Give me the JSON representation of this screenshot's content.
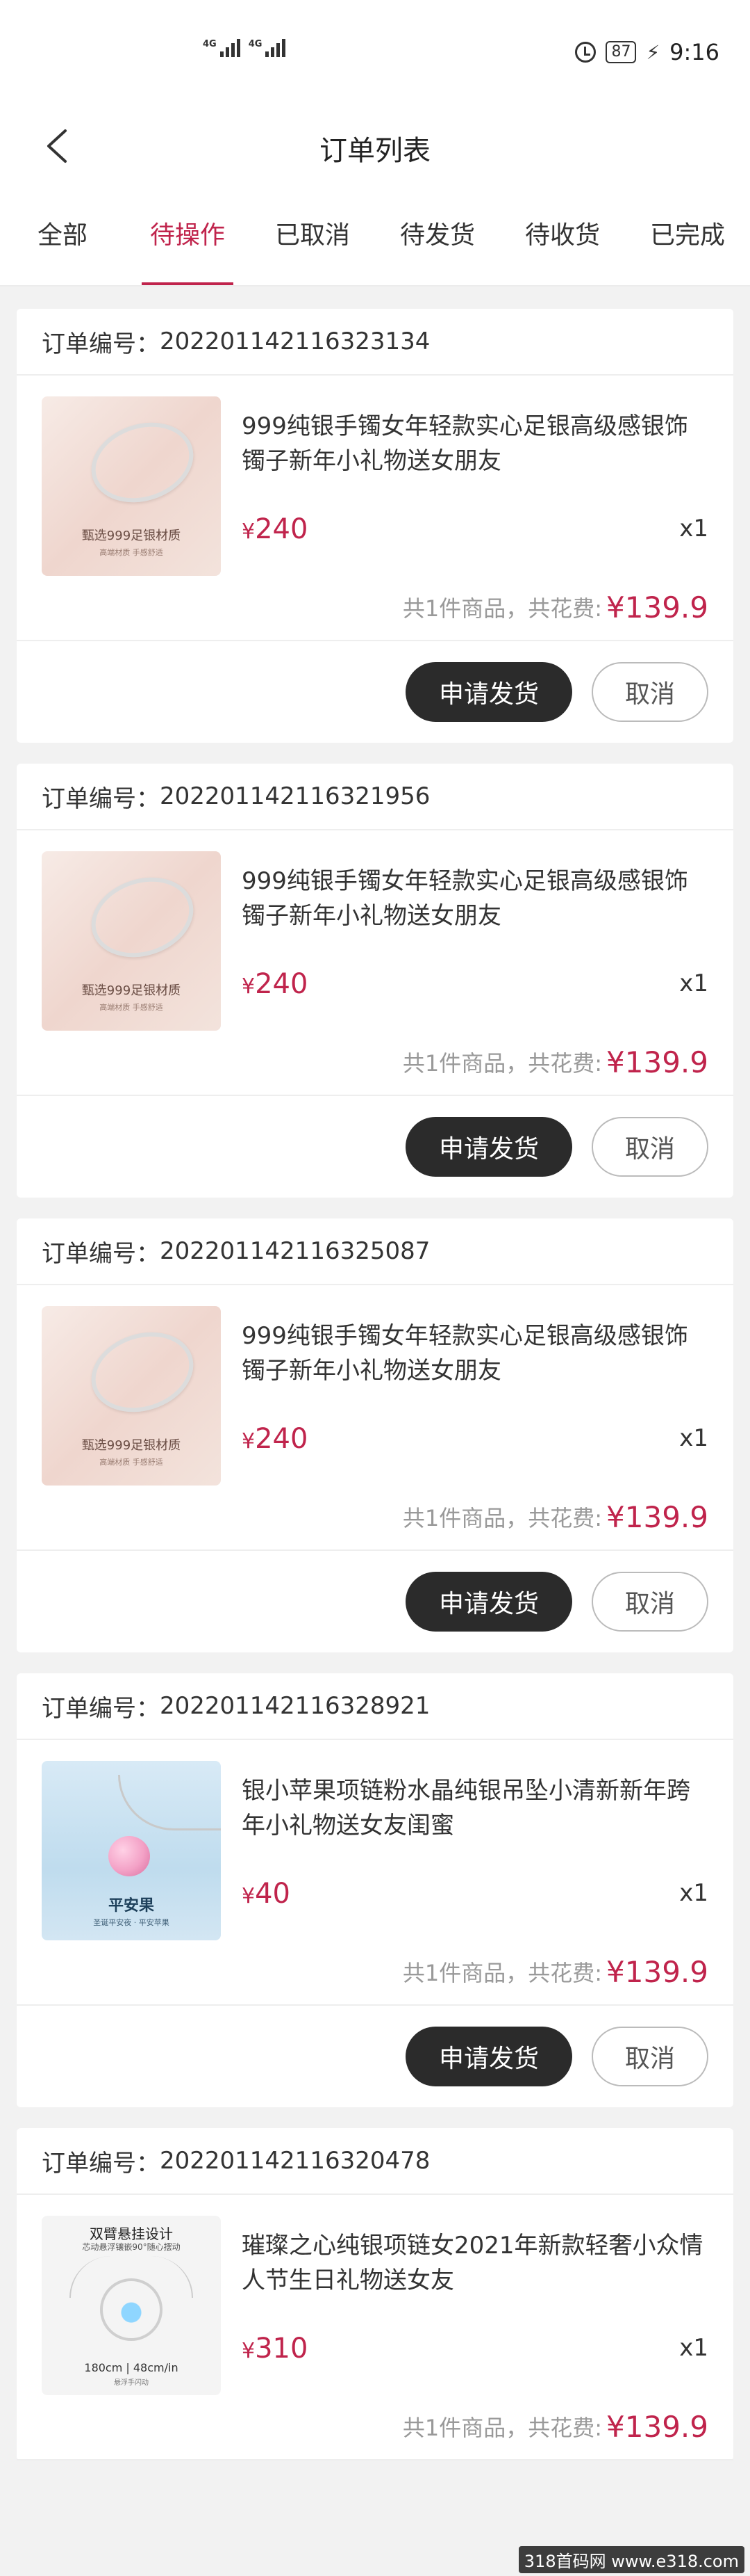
{
  "status_bar": {
    "sim1": "4G",
    "sim2": "4G",
    "battery": "87",
    "time": "9:16"
  },
  "header": {
    "title": "订单列表"
  },
  "tabs": [
    {
      "label": "全部"
    },
    {
      "label": "待操作"
    },
    {
      "label": "已取消"
    },
    {
      "label": "待发货"
    },
    {
      "label": "待收货"
    },
    {
      "label": "已完成"
    }
  ],
  "active_tab": "待操作",
  "orders": [
    {
      "order_label": "订单编号：",
      "order_no": "202201142116323134",
      "product_name": "999纯银手镯女年轻款实心足银高级感银饰镯子新年小礼物送女朋友",
      "currency": "¥",
      "price": "240",
      "qty": "x1",
      "thumb_caption": "甄选999足银材质",
      "thumb_sub": "高端材质 手感舒适",
      "summary_label": "共1件商品，共花费:",
      "total": "¥139.9",
      "primary_btn": "申请发货",
      "secondary_btn": "取消"
    },
    {
      "order_label": "订单编号：",
      "order_no": "202201142116321956",
      "product_name": "999纯银手镯女年轻款实心足银高级感银饰镯子新年小礼物送女朋友",
      "currency": "¥",
      "price": "240",
      "qty": "x1",
      "thumb_caption": "甄选999足银材质",
      "thumb_sub": "高端材质 手感舒适",
      "summary_label": "共1件商品，共花费:",
      "total": "¥139.9",
      "primary_btn": "申请发货",
      "secondary_btn": "取消"
    },
    {
      "order_label": "订单编号：",
      "order_no": "202201142116325087",
      "product_name": "999纯银手镯女年轻款实心足银高级感银饰镯子新年小礼物送女朋友",
      "currency": "¥",
      "price": "240",
      "qty": "x1",
      "thumb_caption": "甄选999足银材质",
      "thumb_sub": "高端材质 手感舒适",
      "summary_label": "共1件商品，共花费:",
      "total": "¥139.9",
      "primary_btn": "申请发货",
      "secondary_btn": "取消"
    },
    {
      "order_label": "订单编号：",
      "order_no": "202201142116328921",
      "product_name": "银小苹果项链粉水晶纯银吊坠小清新新年跨年小礼物送女友闺蜜",
      "currency": "¥",
      "price": "40",
      "qty": "x1",
      "thumb_caption": "平安果",
      "thumb_sub": "圣诞平安夜 · 平安苹果",
      "summary_label": "共1件商品，共花费:",
      "total": "¥139.9",
      "primary_btn": "申请发货",
      "secondary_btn": "取消"
    },
    {
      "order_label": "订单编号：",
      "order_no": "202201142116320478",
      "product_name": "璀璨之心纯银项链女2021年新款轻奢小众情人节生日礼物送女友",
      "currency": "¥",
      "price": "310",
      "qty": "x1",
      "thumb_caption": "双臂悬挂设计",
      "thumb_sub": "芯动悬浮镶嵌90°随心摆动",
      "thumb_caption2": "180cm | 48cm/in",
      "thumb_sub2": "悬浮手闪动",
      "summary_label": "共1件商品，共花费:",
      "total": "¥139.9"
    }
  ],
  "watermark": "318首码网 www.e318.com"
}
